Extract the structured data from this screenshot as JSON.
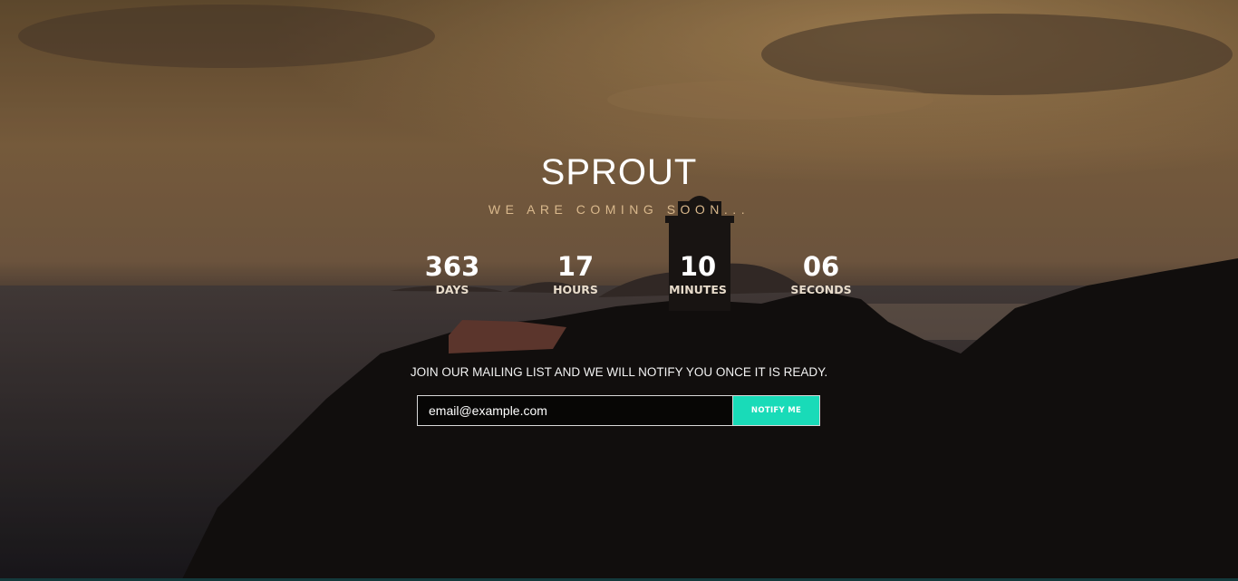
{
  "brand": {
    "name": "SPROUT",
    "tagline": "WE ARE COMING SOON..."
  },
  "countdown": [
    {
      "value": "363",
      "label": "DAYS"
    },
    {
      "value": "17",
      "label": "HOURS"
    },
    {
      "value": "10",
      "label": "MINUTES"
    },
    {
      "value": "06",
      "label": "SECONDS"
    }
  ],
  "mailing": {
    "text": "JOIN OUR MAILING LIST AND WE WILL NOTIFY YOU ONCE IT IS READY.",
    "email_value": "email@example.com",
    "button_label": "NOTIFY ME"
  },
  "colors": {
    "accent": "#19dbb8",
    "tagline": "#d9b88c"
  }
}
